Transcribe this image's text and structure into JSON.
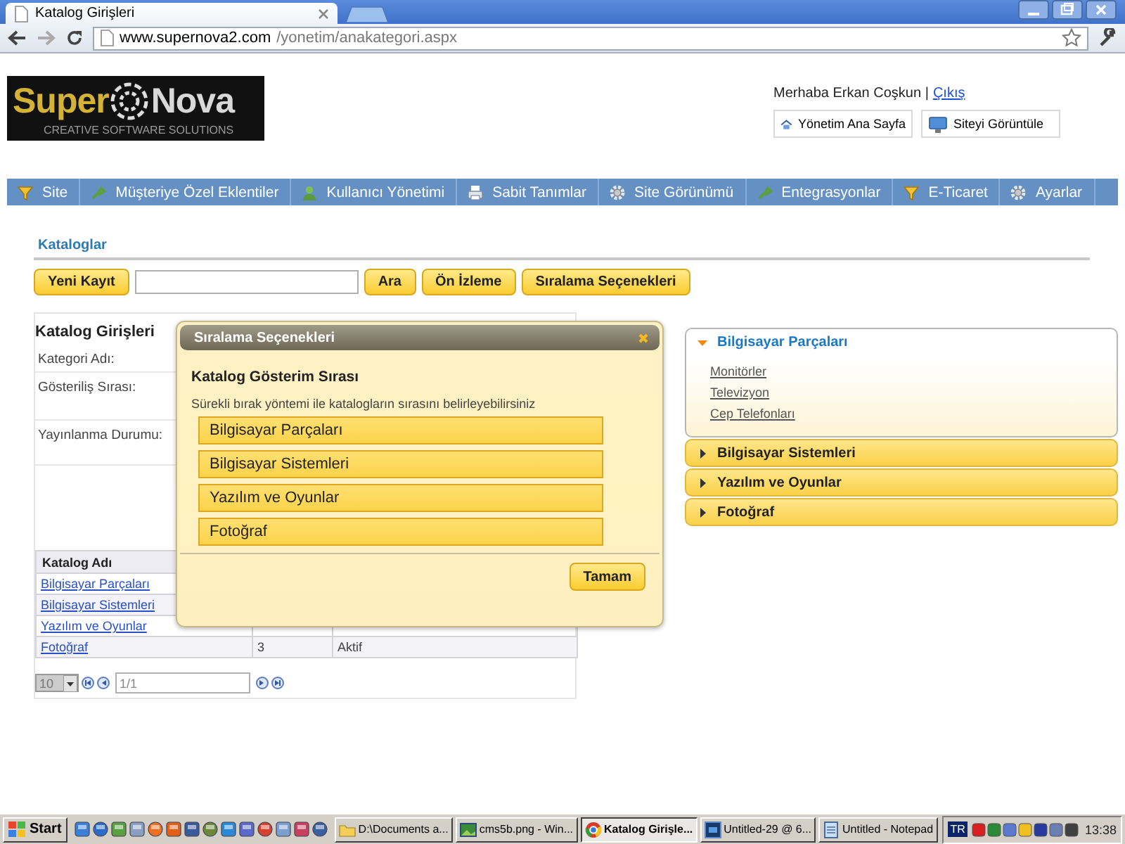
{
  "browser": {
    "tabs": [
      {
        "title": "Katalog Girişleri",
        "selected": true
      }
    ],
    "url_host": "www.supernova2.com",
    "url_path": "/yonetim/anakategori.aspx"
  },
  "header": {
    "logo": {
      "word1": "Super",
      "word2": "Nova",
      "tagline": "CREATIVE SOFTWARE SOLUTIONS"
    },
    "greeting": "Merhaba Erkan Coşkun |",
    "logout": "Çıkış",
    "buttons": [
      {
        "label": "Yönetim Ana Sayfa",
        "kind": "home"
      },
      {
        "label": "Siteyi Görüntüle",
        "kind": "monitor"
      }
    ]
  },
  "nav": [
    {
      "label": "Site",
      "kind": "funnel"
    },
    {
      "label": "Müşteriye Özel Eklentiler",
      "kind": "plug"
    },
    {
      "label": "Kullanıcı Yönetimi",
      "kind": "user"
    },
    {
      "label": "Sabit Tanımlar",
      "kind": "printer"
    },
    {
      "label": "Site Görünümü",
      "kind": "gear"
    },
    {
      "label": "Entegrasyonlar",
      "kind": "plug"
    },
    {
      "label": "E-Ticaret",
      "kind": "funnel"
    },
    {
      "label": "Ayarlar",
      "kind": "gear"
    }
  ],
  "section_title": "Kataloglar",
  "toolbar": {
    "new_button": "Yeni Kayıt",
    "buttons": [
      "Ara",
      "Ön İzleme",
      "Sıralama Seçenekleri"
    ]
  },
  "form": {
    "title": "Katalog Girişleri",
    "fields": [
      "Kategori Adı:",
      "Gösteriliş Sırası:",
      "Yayınlanma Durumu:"
    ]
  },
  "table": {
    "columns": [
      "Katalog Adı"
    ],
    "rows": [
      {
        "name": "Bilgisayar Parçaları"
      },
      {
        "name": "Bilgisayar Sistemleri"
      },
      {
        "name": "Yazılım ve Oyunlar"
      },
      {
        "name": "Fotoğraf",
        "order": "3",
        "status": "Aktif"
      }
    ]
  },
  "pager": {
    "page_size": "10",
    "page": "1/1"
  },
  "modal": {
    "title": "Sıralama Seçenekleri",
    "heading": "Katalog Gösterim Sırası",
    "hint": "Sürekli bırak yöntemi ile katalogların sırasını belirleyebilirsiniz",
    "items": [
      "Bilgisayar Parçaları",
      "Bilgisayar Sistemleri",
      "Yazılım ve Oyunlar",
      "Fotoğraf"
    ],
    "ok": "Tamam"
  },
  "accordion": [
    {
      "title": "Bilgisayar Parçaları",
      "expanded": true,
      "children": [
        "Monitörler",
        "Televizyon",
        "Cep Telefonları"
      ]
    },
    {
      "title": "Bilgisayar Sistemleri",
      "expanded": false
    },
    {
      "title": "Yazılım ve Oyunlar",
      "expanded": false
    },
    {
      "title": "Fotoğraf",
      "expanded": false
    }
  ],
  "taskbar": {
    "start": "Start",
    "tasks": [
      {
        "label": "D:\\Documents a...",
        "kind": "folder",
        "selected": false
      },
      {
        "label": "cms5b.png - Win...",
        "kind": "image",
        "selected": false
      },
      {
        "label": "Katalog Girişle...",
        "kind": "browser",
        "selected": true
      },
      {
        "label": "Untitled-29 @ 6...",
        "kind": "ps",
        "selected": false
      },
      {
        "label": "Untitled - Notepad",
        "kind": "notepad",
        "selected": false
      }
    ],
    "lang": "TR",
    "clock": "13:38"
  }
}
